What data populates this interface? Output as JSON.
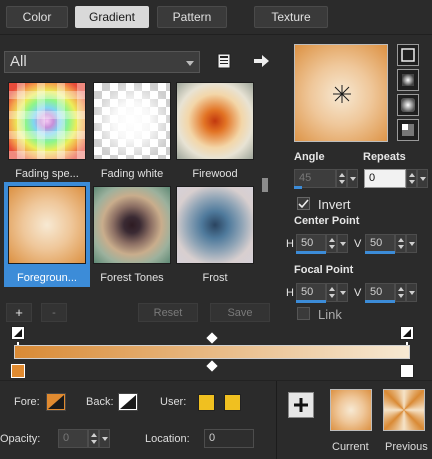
{
  "tabs": [
    {
      "label": "Color",
      "active": false
    },
    {
      "label": "Gradient",
      "active": true
    },
    {
      "label": "Pattern",
      "active": false
    },
    {
      "label": "Texture",
      "active": false
    }
  ],
  "library": {
    "selected": "All"
  },
  "gradients": [
    {
      "label": "Fading spe...",
      "selected": false
    },
    {
      "label": "Fading white",
      "selected": false
    },
    {
      "label": "Firewood",
      "selected": false
    },
    {
      "label": "Foregroun...",
      "selected": true
    },
    {
      "label": "Forest Tones",
      "selected": false
    },
    {
      "label": "Frost",
      "selected": false
    }
  ],
  "buttons": {
    "add": "+",
    "remove": "-",
    "reset": "Reset",
    "save": "Save"
  },
  "settings": {
    "angle_label": "Angle",
    "angle_value": "45",
    "repeats_label": "Repeats",
    "repeats_value": "0",
    "invert_label": "Invert",
    "invert_checked": true,
    "center_label": "Center Point",
    "center_h_label": "H",
    "center_h": "50",
    "center_v_label": "V",
    "center_v": "50",
    "focal_label": "Focal Point",
    "focal_h_label": "H",
    "focal_h": "50",
    "focal_v_label": "V",
    "focal_v": "50",
    "link_label": "Link",
    "link_checked": false
  },
  "bottom": {
    "fore_label": "Fore:",
    "back_label": "Back:",
    "user_label": "User:",
    "opacity_label": "Opacity:",
    "opacity_value": "0",
    "location_label": "Location:",
    "location_value": "0",
    "current_label": "Current",
    "previous_label": "Previous"
  },
  "colors": {
    "accent": "#3c8cd8",
    "gradient_dark": "#d98a35",
    "gradient_light": "#f7e9d3",
    "user_yellow": "#f0c020"
  }
}
